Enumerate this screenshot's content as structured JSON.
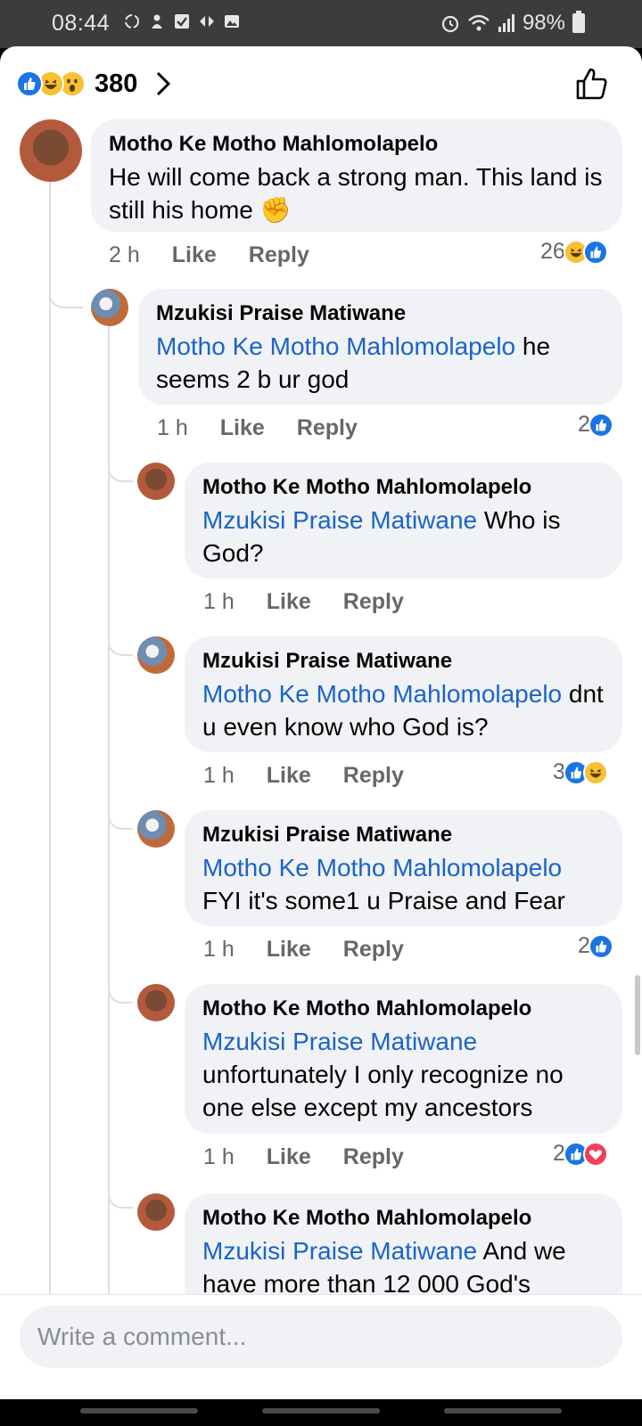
{
  "status_bar": {
    "time": "08:44",
    "battery": "98%"
  },
  "reactions": {
    "count": "380"
  },
  "composer": {
    "placeholder": "Write a comment..."
  },
  "comments": [
    {
      "author": "Motho Ke Motho Mahlomolapelo",
      "mention": "",
      "text": "He will come back a strong man. This land is still his home",
      "emoji": "✊",
      "time": "2 h",
      "like": "Like",
      "reply": "Reply",
      "reaction_count": "26"
    },
    {
      "author": "Mzukisi Praise Matiwane",
      "mention": "Motho Ke Motho Mahlomolapelo",
      "text": "he seems 2 b ur god",
      "time": "1 h",
      "like": "Like",
      "reply": "Reply",
      "reaction_count": "2"
    },
    {
      "author": "Motho Ke Motho Mahlomolapelo",
      "mention": "Mzukisi Praise Matiwane",
      "text": "Who is God?",
      "time": "1 h",
      "like": "Like",
      "reply": "Reply",
      "reaction_count": ""
    },
    {
      "author": "Mzukisi Praise Matiwane",
      "mention": "Motho Ke Motho Mahlomolapelo",
      "text": "dnt u even know who God is?",
      "time": "1 h",
      "like": "Like",
      "reply": "Reply",
      "reaction_count": "3"
    },
    {
      "author": "Mzukisi Praise Matiwane",
      "mention": "Motho Ke Motho Mahlomolapelo",
      "text": "FYI it's some1 u Praise and Fear",
      "time": "1 h",
      "like": "Like",
      "reply": "Reply",
      "reaction_count": "2"
    },
    {
      "author": "Motho Ke Motho Mahlomolapelo",
      "mention": "Mzukisi Praise Matiwane",
      "text": "unfortunately I only recognize no one else except my ancestors",
      "time": "1 h",
      "like": "Like",
      "reply": "Reply",
      "reaction_count": "2"
    },
    {
      "author": "Motho Ke Motho Mahlomolapelo",
      "mention": "Mzukisi Praise Matiwane",
      "text": " And we have more than 12 000 God's",
      "time": "",
      "like": "",
      "reply": "",
      "reaction_count": ""
    }
  ],
  "colors": {
    "accent": "#1b74e4",
    "mention": "#1b64c6",
    "bubble": "#f0f2f5",
    "meta": "#65676b"
  }
}
